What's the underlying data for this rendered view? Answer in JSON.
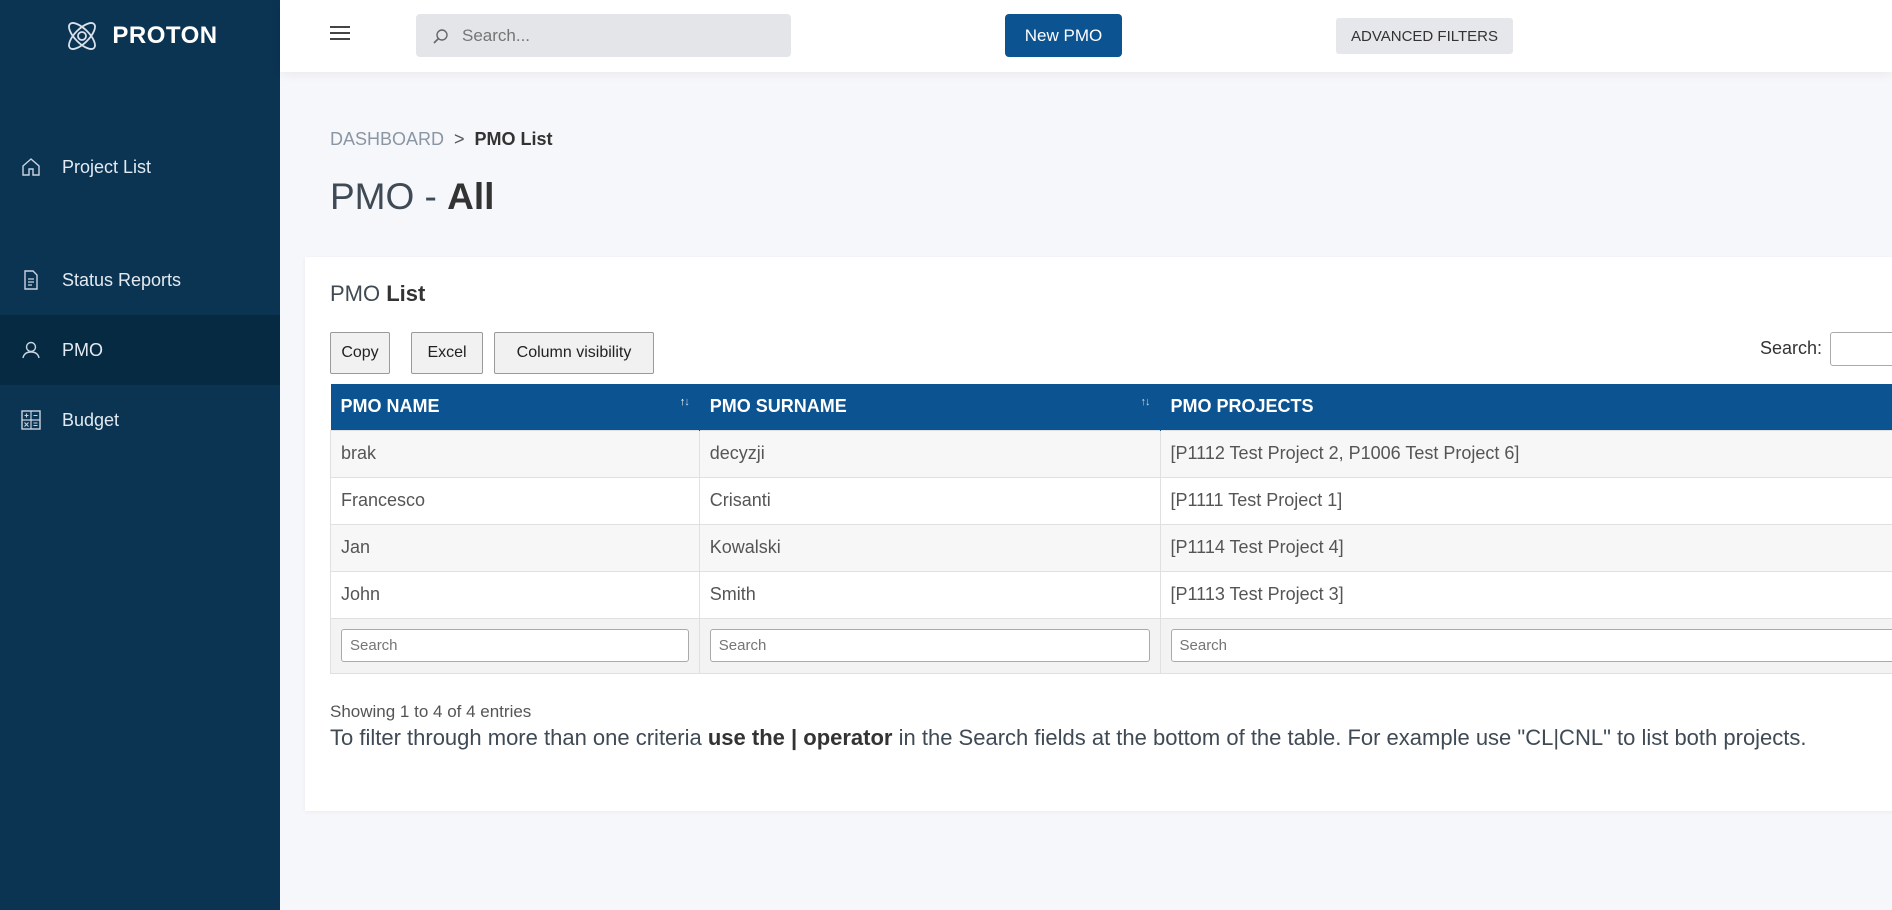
{
  "brand": {
    "name": "PROTON",
    "logo_icon": "atom-icon"
  },
  "sidebar": {
    "items": [
      {
        "label": "Project List",
        "icon": "home-icon",
        "active": false
      },
      {
        "label": "Status Reports",
        "icon": "document-icon",
        "active": false
      },
      {
        "label": "PMO",
        "icon": "user-icon",
        "active": true
      },
      {
        "label": "Budget",
        "icon": "calculator-icon",
        "active": false
      }
    ]
  },
  "topbar": {
    "search_placeholder": "Search...",
    "new_button": "New PMO",
    "advanced_filters": "ADVANCED FILTERS"
  },
  "breadcrumb": {
    "parent": "DASHBOARD",
    "separator": ">",
    "current": "PMO List"
  },
  "page_title": {
    "prefix": "PMO - ",
    "bold": "All"
  },
  "card": {
    "title_prefix": "PMO ",
    "title_bold": "List",
    "buttons": {
      "copy": "Copy",
      "excel": "Excel",
      "colvis": "Column visibility"
    },
    "search_label": "Search:"
  },
  "table": {
    "columns": [
      "PMO NAME",
      "PMO SURNAME",
      "PMO PROJECTS"
    ],
    "rows": [
      [
        "brak",
        "decyzji",
        "[P1112 Test Project 2, P1006 Test Project 6]"
      ],
      [
        "Francesco",
        "Crisanti",
        "[P1111 Test Project 1]"
      ],
      [
        "Jan",
        "Kowalski",
        "[P1114 Test Project 4]"
      ],
      [
        "John",
        "Smith",
        "[P1113 Test Project 3]"
      ]
    ],
    "footer_placeholder": "Search"
  },
  "info": "Showing 1 to 4 of 4 entries",
  "hint": {
    "part1": "To filter through more than one criteria ",
    "bold": "use the | operator",
    "part2": " in the Search fields at the bottom of the table. For example use \"CL|CNL\" to list both projects."
  },
  "colors": {
    "sidebar": "#0b3452",
    "sidebar_active": "#072a43",
    "accent": "#0b5391"
  }
}
